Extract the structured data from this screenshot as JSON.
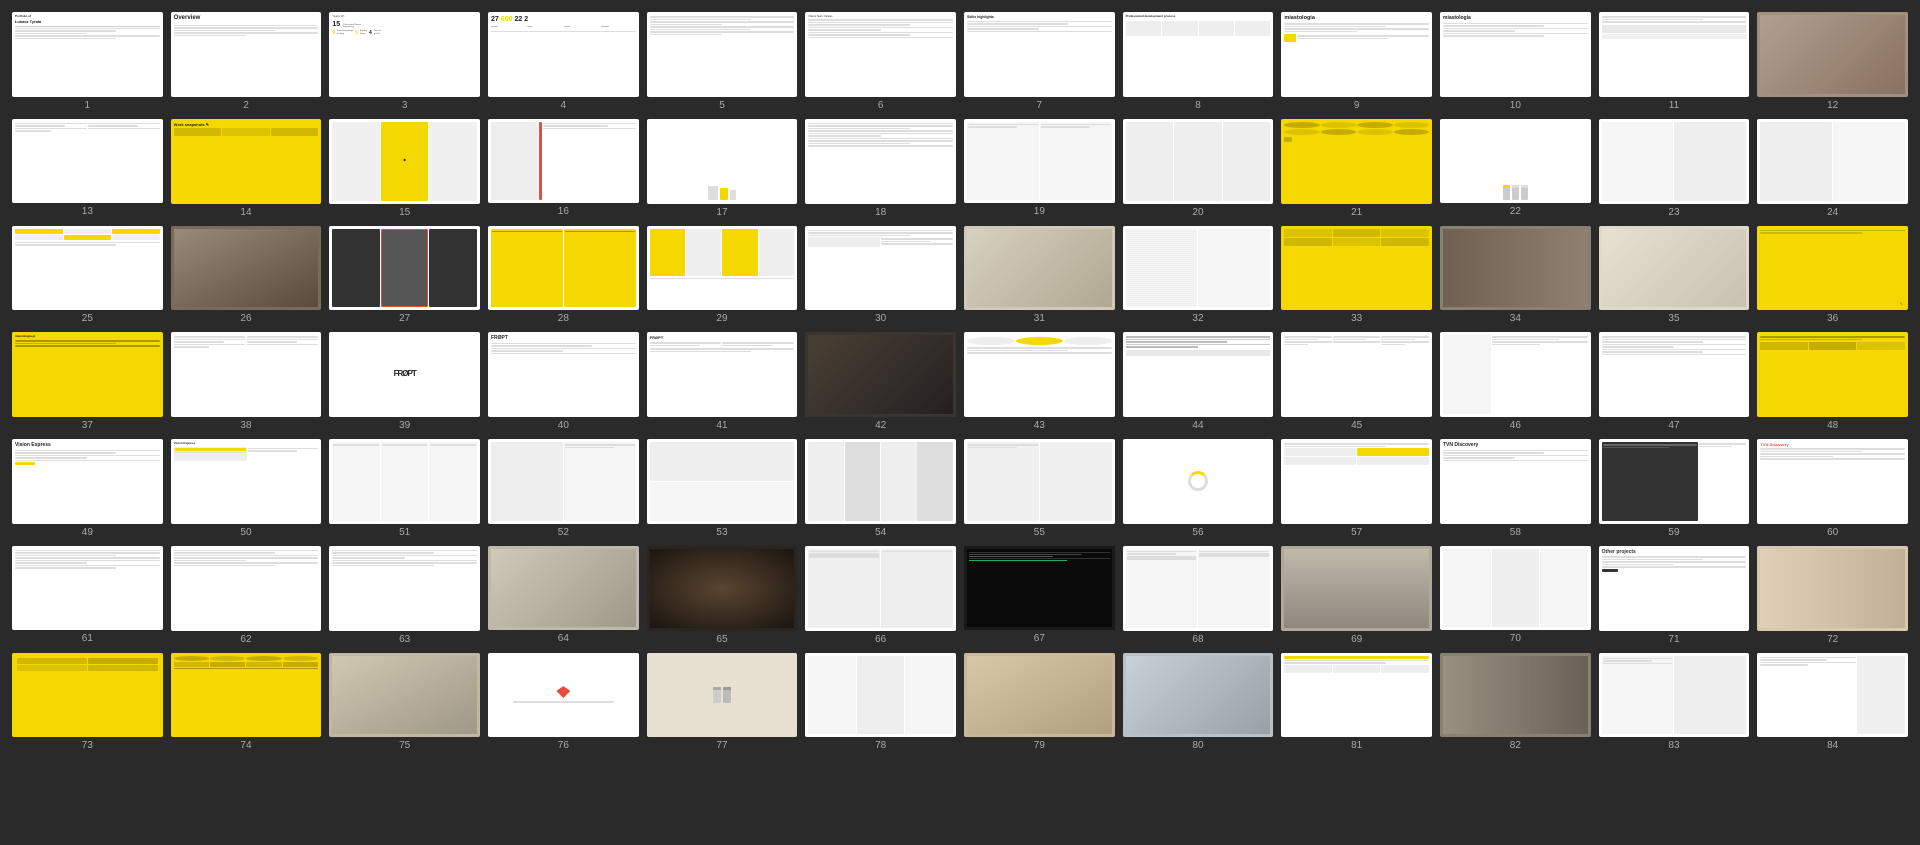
{
  "slides": [
    {
      "id": 1,
      "type": "portfolio-cover",
      "label": "1"
    },
    {
      "id": 2,
      "type": "overview",
      "label": "2"
    },
    {
      "id": 3,
      "type": "years-of",
      "label": "3"
    },
    {
      "id": 4,
      "type": "numbers",
      "label": "4"
    },
    {
      "id": 5,
      "type": "clients",
      "label": "5"
    },
    {
      "id": 6,
      "type": "text-list",
      "label": "6"
    },
    {
      "id": 7,
      "type": "skills",
      "label": "7"
    },
    {
      "id": 8,
      "type": "process",
      "label": "8"
    },
    {
      "id": 9,
      "type": "miastologia-1",
      "label": "9"
    },
    {
      "id": 10,
      "type": "miastologia-2",
      "label": "10"
    },
    {
      "id": 11,
      "type": "miastologia-3",
      "label": "11"
    },
    {
      "id": 12,
      "type": "photo-slide",
      "label": "12"
    },
    {
      "id": 13,
      "type": "wireframes-1",
      "label": "13"
    },
    {
      "id": 14,
      "type": "yellow-patterns",
      "label": "14"
    },
    {
      "id": 15,
      "type": "wireframes-2",
      "label": "15"
    },
    {
      "id": 16,
      "type": "ui-detail",
      "label": "16"
    },
    {
      "id": 17,
      "type": "devices",
      "label": "17"
    },
    {
      "id": 18,
      "type": "text-dense",
      "label": "18"
    },
    {
      "id": 19,
      "type": "wireframes-3",
      "label": "19"
    },
    {
      "id": 20,
      "type": "wireframes-4",
      "label": "20"
    },
    {
      "id": 21,
      "type": "yellow-patterns-2",
      "label": "21"
    },
    {
      "id": 22,
      "type": "app-screens",
      "label": "22"
    },
    {
      "id": 23,
      "type": "wireframes-5",
      "label": "23"
    },
    {
      "id": 24,
      "type": "wireframes-6",
      "label": "24"
    },
    {
      "id": 25,
      "type": "ui-components",
      "label": "25"
    },
    {
      "id": 26,
      "type": "photo-office",
      "label": "26"
    },
    {
      "id": 27,
      "type": "dark-wireframes",
      "label": "27"
    },
    {
      "id": 28,
      "type": "yellow-ui",
      "label": "28"
    },
    {
      "id": 29,
      "type": "wireframes-7",
      "label": "29"
    },
    {
      "id": 30,
      "type": "text-mixed",
      "label": "30"
    },
    {
      "id": 31,
      "type": "product-photo",
      "label": "31"
    },
    {
      "id": 32,
      "type": "sketches",
      "label": "32"
    },
    {
      "id": 33,
      "type": "yellow-sticky",
      "label": "33"
    },
    {
      "id": 34,
      "type": "tools-photo",
      "label": "34"
    },
    {
      "id": 35,
      "type": "photo-hands",
      "label": "35"
    },
    {
      "id": 36,
      "type": "yellow-drawing",
      "label": "36"
    },
    {
      "id": 37,
      "type": "yellow-card",
      "label": "37"
    },
    {
      "id": 38,
      "type": "text-2col",
      "label": "38"
    },
    {
      "id": 39,
      "type": "fropt-logo",
      "label": "39"
    },
    {
      "id": 40,
      "type": "fropt-2",
      "label": "40"
    },
    {
      "id": 41,
      "type": "fropt-3",
      "label": "41"
    },
    {
      "id": 42,
      "type": "photo-dark",
      "label": "42"
    },
    {
      "id": 43,
      "type": "diagram",
      "label": "43"
    },
    {
      "id": 44,
      "type": "handwriting",
      "label": "44"
    },
    {
      "id": 45,
      "type": "text-cols-3",
      "label": "45"
    },
    {
      "id": 46,
      "type": "wireframes-8",
      "label": "46"
    },
    {
      "id": 47,
      "type": "text-fropt",
      "label": "47"
    },
    {
      "id": 48,
      "type": "yellow-diagram",
      "label": "48"
    },
    {
      "id": 49,
      "type": "vision-express",
      "label": "49"
    },
    {
      "id": 50,
      "type": "ve-2",
      "label": "50"
    },
    {
      "id": 51,
      "type": "ve-3",
      "label": "51"
    },
    {
      "id": 52,
      "type": "ve-4",
      "label": "52"
    },
    {
      "id": 53,
      "type": "ve-5",
      "label": "53"
    },
    {
      "id": 54,
      "type": "ve-6",
      "label": "54"
    },
    {
      "id": 55,
      "type": "ve-7",
      "label": "55"
    },
    {
      "id": 56,
      "type": "circle-diagram",
      "label": "56"
    },
    {
      "id": 57,
      "type": "ve-8",
      "label": "57"
    },
    {
      "id": 58,
      "type": "tvn-discovery",
      "label": "58"
    },
    {
      "id": 59,
      "type": "tvn-2",
      "label": "59"
    },
    {
      "id": 60,
      "type": "tvn-3",
      "label": "60"
    },
    {
      "id": 61,
      "type": "text-blocks",
      "label": "61"
    },
    {
      "id": 62,
      "type": "text-blocks-2",
      "label": "62"
    },
    {
      "id": 63,
      "type": "text-blocks-3",
      "label": "63"
    },
    {
      "id": 64,
      "type": "photo-team",
      "label": "64"
    },
    {
      "id": 65,
      "type": "concert-photo",
      "label": "65"
    },
    {
      "id": 66,
      "type": "ui-screens-2",
      "label": "66"
    },
    {
      "id": 67,
      "type": "dark-code",
      "label": "67"
    },
    {
      "id": 68,
      "type": "wireframes-9",
      "label": "68"
    },
    {
      "id": 69,
      "type": "photo-mobile",
      "label": "69"
    },
    {
      "id": 70,
      "type": "wireframes-10",
      "label": "70"
    },
    {
      "id": 71,
      "type": "other-projects",
      "label": "71"
    },
    {
      "id": 72,
      "type": "photo-collage",
      "label": "72"
    },
    {
      "id": 73,
      "type": "yellow-full",
      "label": "73"
    },
    {
      "id": 74,
      "type": "yellow-icons",
      "label": "74"
    },
    {
      "id": 75,
      "type": "photo-people",
      "label": "75"
    },
    {
      "id": 76,
      "type": "ui-heart",
      "label": "76"
    },
    {
      "id": 77,
      "type": "mobile-screens",
      "label": "77"
    },
    {
      "id": 78,
      "type": "wireframes-11",
      "label": "78"
    },
    {
      "id": 79,
      "type": "food-photo",
      "label": "79"
    },
    {
      "id": 80,
      "type": "architecture-photo",
      "label": "80"
    },
    {
      "id": 81,
      "type": "ui-website",
      "label": "81"
    },
    {
      "id": 82,
      "type": "photo-office-2",
      "label": "82"
    },
    {
      "id": 83,
      "type": "wireframes-12",
      "label": "83"
    },
    {
      "id": 84,
      "type": "handwriting-2",
      "label": "84"
    }
  ],
  "bg_color": "#2a2a2a",
  "number_color": "#aaaaaa"
}
